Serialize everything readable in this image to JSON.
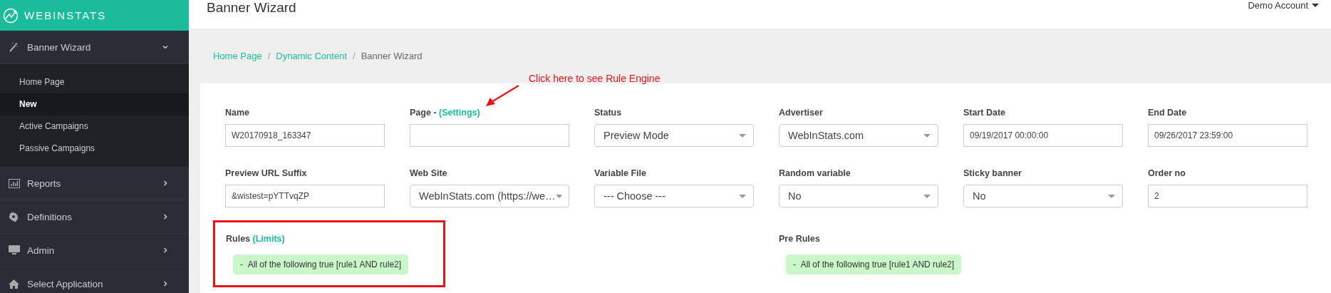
{
  "brand": {
    "name": "WEBINSTATS"
  },
  "sidebar": {
    "items": [
      {
        "label": "Banner Wizard",
        "expanded": true,
        "children": [
          {
            "label": "Home Page",
            "selected": false
          },
          {
            "label": "New",
            "selected": true
          },
          {
            "label": "Active Campaigns",
            "selected": false
          },
          {
            "label": "Passive Campaigns",
            "selected": false
          }
        ]
      },
      {
        "label": "Reports",
        "expanded": false
      },
      {
        "label": "Definitions",
        "expanded": false
      },
      {
        "label": "Admin",
        "expanded": false
      },
      {
        "label": "Select Application",
        "expanded": false
      }
    ]
  },
  "header": {
    "title": "Banner Wizard",
    "account": "Demo Account"
  },
  "breadcrumb": [
    {
      "label": "Home Page",
      "link": true
    },
    {
      "separator": "/",
      "label": "Dynamic Content",
      "link": true
    },
    {
      "separator": "/",
      "label": "Banner Wizard",
      "link": false
    }
  ],
  "annotation": {
    "text": "Click here to see Rule Engine"
  },
  "form": {
    "fields": [
      {
        "label": "Name",
        "kind": "text",
        "value": "W20170918_163347"
      },
      {
        "label": "Page -",
        "link": "(Settings)",
        "kind": "text"
      },
      {
        "label": "Status",
        "kind": "select",
        "value": "Preview Mode"
      },
      {
        "label": "Advertiser",
        "kind": "select",
        "value": "WebInStats.com"
      },
      {
        "label": "Start Date",
        "kind": "text",
        "value": "09/19/2017 00:00:00"
      },
      {
        "label": "End Date",
        "kind": "text",
        "value": "09/26/2017 23:59:00"
      },
      {
        "label": "Preview URL Suffix",
        "kind": "text",
        "value": "&wistest=pYTTvqZP"
      },
      {
        "label": "Web Site",
        "kind": "select",
        "value": "WebInStats.com (https://we…"
      },
      {
        "label": "Variable File",
        "kind": "select",
        "value": "--- Choose ---"
      },
      {
        "label": "Random variable",
        "kind": "select",
        "value": "No"
      },
      {
        "label": "Sticky banner",
        "kind": "select",
        "value": "No"
      },
      {
        "label": "Order no",
        "kind": "text",
        "value": "2"
      }
    ]
  },
  "rules": {
    "label": "Rules",
    "link": "(Limits)",
    "highlighted": true,
    "items": [
      {
        "bullet": "-",
        "text": "All of the following true [rule1 AND rule2]"
      }
    ]
  },
  "pre_rules": {
    "label": "Pre Rules",
    "items": [
      {
        "bullet": "-",
        "text": "All of the following true [rule1 AND rule2]"
      }
    ]
  }
}
